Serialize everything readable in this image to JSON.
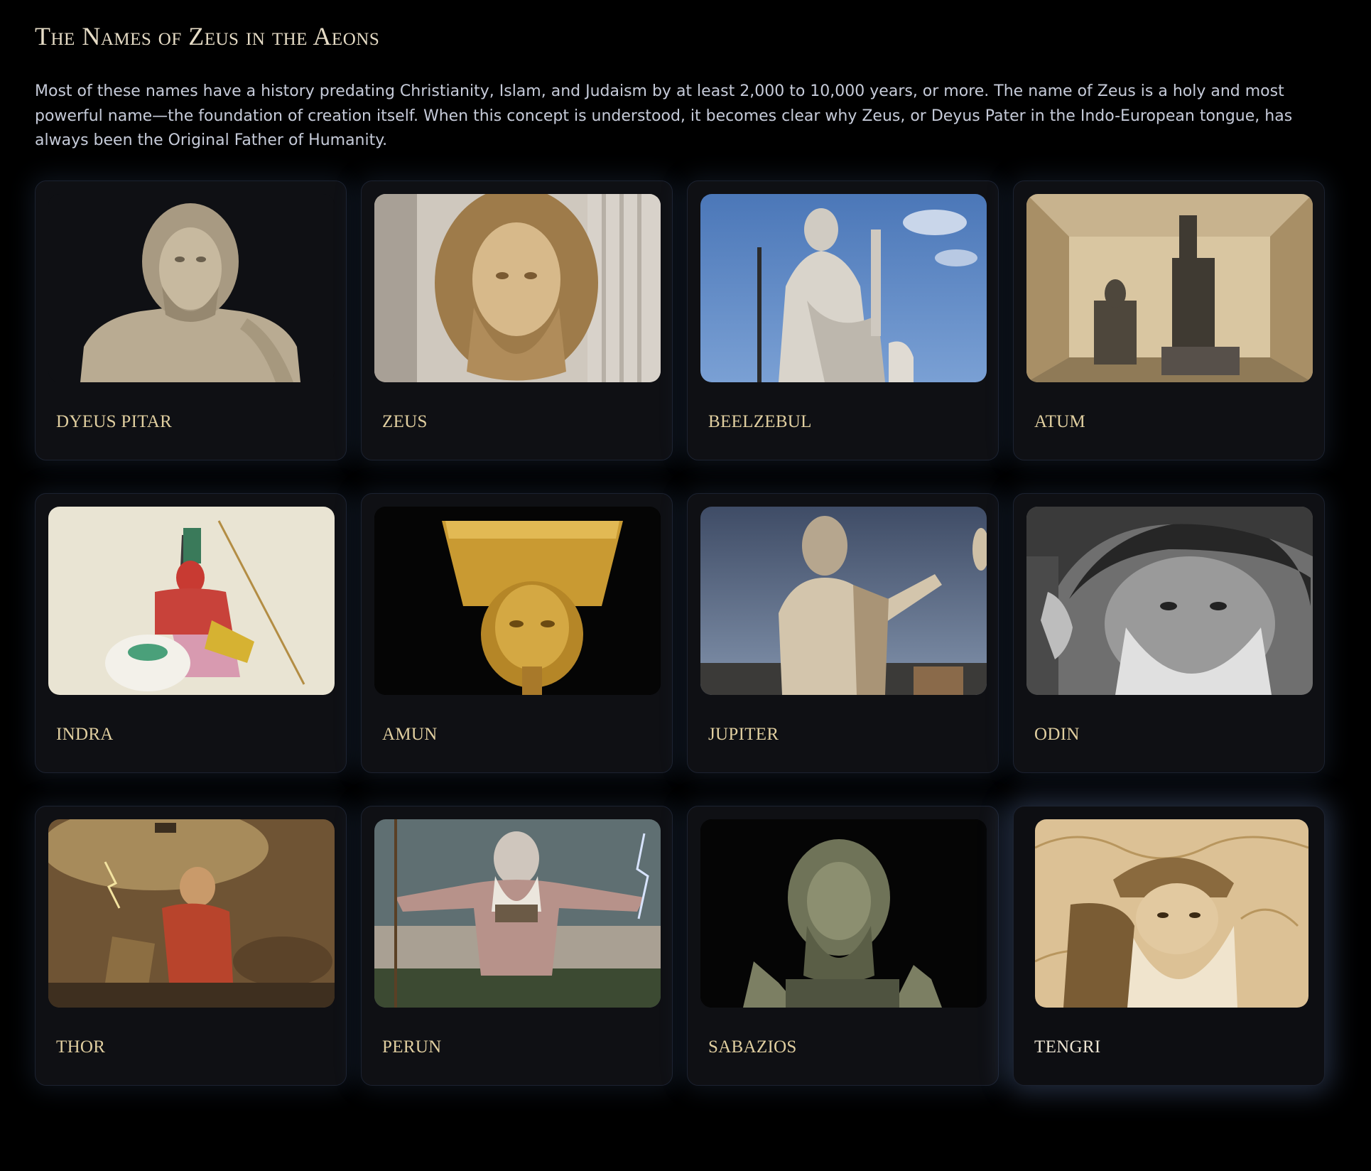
{
  "page": {
    "title": "The Names of Zeus in the Aeons",
    "intro": "Most of these names have a history predating Christianity, Islam, and Judaism by at least 2,000 to 10,000 years, or more. The name of Zeus is a holy and most powerful name—the foundation of creation itself. When this concept is understood, it becomes clear why Zeus, or Deyus Pater in the Indo-European tongue, has always been the Original Father of Humanity."
  },
  "colors": {
    "background": "#000000",
    "card_background": "#0f1014",
    "card_border": "#1c2230",
    "label_gold": "#e1cfa0",
    "intro_text": "#c6cbd9",
    "title": "#e6dcc6"
  },
  "cards": [
    {
      "label": "DYEUS PITAR",
      "image": "marble-bust-bearded-dark-background"
    },
    {
      "label": "ZEUS",
      "image": "marble-head-curly-hair-beard"
    },
    {
      "label": "BEELZEBUL",
      "image": "marble-statue-blue-sky-eagle"
    },
    {
      "label": "ATUM",
      "image": "egyptian-seated-statues-niche"
    },
    {
      "label": "INDRA",
      "image": "indian-painting-red-god-on-elephant"
    },
    {
      "label": "AMUN",
      "image": "golden-head-tall-crown"
    },
    {
      "label": "JUPITER",
      "image": "marble-statue-raised-arm-museum"
    },
    {
      "label": "ODIN",
      "image": "grayscale-bearded-man-hat"
    },
    {
      "label": "THOR",
      "image": "painting-thor-hammer-lightning"
    },
    {
      "label": "PERUN",
      "image": "painting-bearded-giant-lightning-army"
    },
    {
      "label": "SABAZIOS",
      "image": "bronze-bust-dark-background"
    },
    {
      "label": "TENGRI",
      "image": "sepia-illustration-bearded-man-hat",
      "highlighted": true
    }
  ]
}
